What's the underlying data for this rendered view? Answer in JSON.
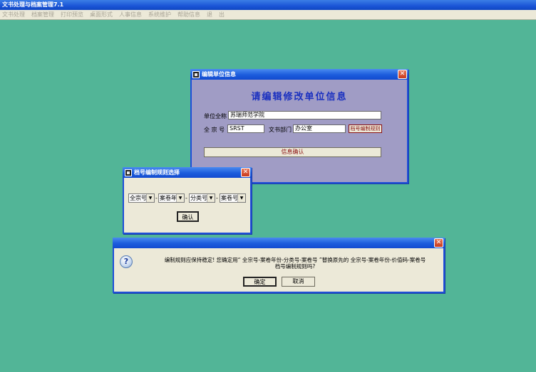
{
  "app": {
    "title": "文书处理与档案管理7.1",
    "menu": [
      "文书处理",
      "档案管理",
      "打印预览",
      "桌面形式",
      "人事信息",
      "系统维护",
      "帮助信息",
      "退",
      "出"
    ]
  },
  "unit_window": {
    "title": "编辑单位信息",
    "heading": "请编辑修改单位信息",
    "fullname_label": "单位全称",
    "fullname_value": "苏瑞师范学院",
    "fonds_label": "全 宗 号",
    "fonds_value": "SRST",
    "dept_label": "文书部门",
    "dept_value": "办公室",
    "rule_button": "档号编制规则",
    "confirm_button": "信息确认"
  },
  "rule_window": {
    "title": "档号编制规则选择",
    "combos": [
      "全宗号",
      "案卷年",
      "分类号",
      "案卷号"
    ],
    "separator": "-",
    "ok_button": "确认"
  },
  "message_window": {
    "line1": "编制规则应保持稳定! 您确定用“ 全宗号-案卷年份-分类号-案卷号 ”替换原先的 全宗号-案卷年份-价值码-案卷号",
    "line2": "档号编制规则吗?",
    "ok_button": "确定",
    "cancel_button": "取消"
  },
  "icons": {
    "close": "close-icon",
    "question": "question-icon",
    "window": "app-window-icon"
  },
  "colors": {
    "desktop": "#52b597",
    "titlebar": "#1c5cdc",
    "unit_window_bg": "#a09cc5",
    "heading": "#1a30c0"
  }
}
